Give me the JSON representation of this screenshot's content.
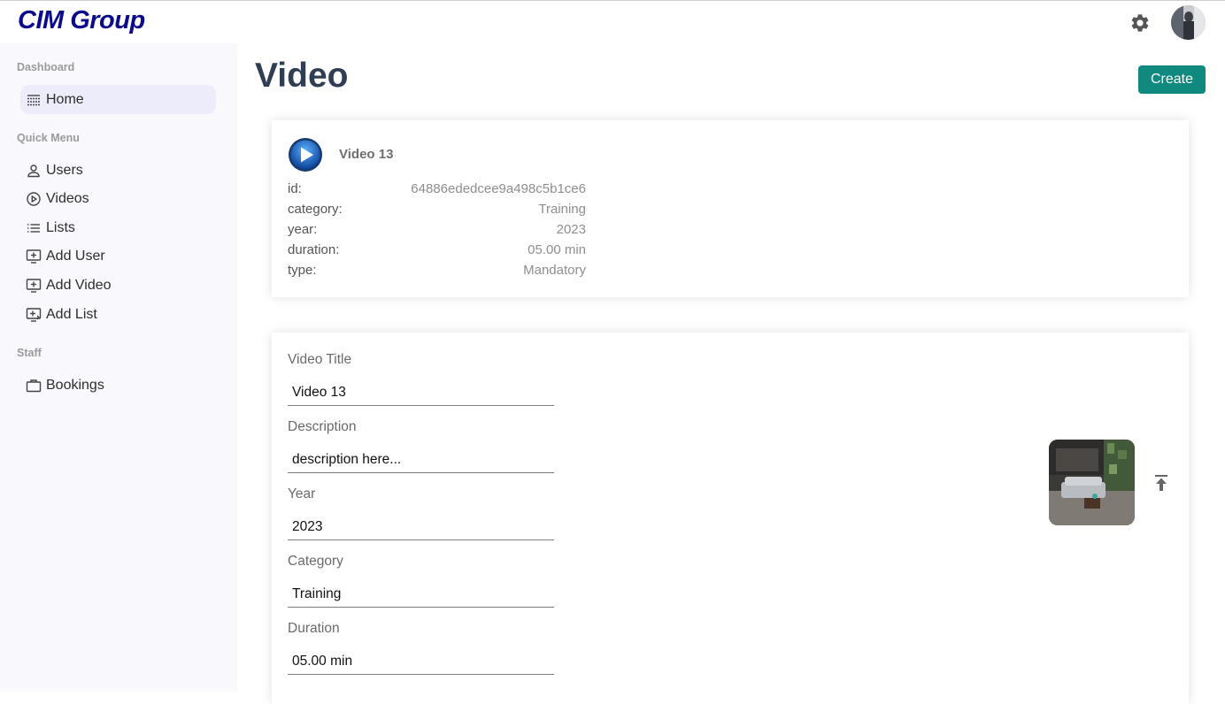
{
  "header": {
    "logo": "CIM Group",
    "settings_icon": "gear-icon",
    "avatar_icon": "user-avatar"
  },
  "sidebar": {
    "sections": [
      {
        "title": "Dashboard",
        "items": [
          {
            "label": "Home",
            "icon": "dashboard-icon",
            "active": true
          }
        ]
      },
      {
        "title": "Quick Menu",
        "items": [
          {
            "label": "Users",
            "icon": "user-icon"
          },
          {
            "label": "Videos",
            "icon": "play-circle-icon"
          },
          {
            "label": "Lists",
            "icon": "list-icon"
          },
          {
            "label": "Add User",
            "icon": "add-box-icon"
          },
          {
            "label": "Add Video",
            "icon": "add-box-icon"
          },
          {
            "label": "Add List",
            "icon": "add-list-icon"
          }
        ]
      },
      {
        "title": "Staff",
        "items": [
          {
            "label": "Bookings",
            "icon": "briefcase-icon"
          }
        ]
      }
    ]
  },
  "main": {
    "title": "Video",
    "create_label": "Create",
    "info": {
      "name": "Video 13",
      "rows": [
        {
          "key": "id:",
          "value": "64886ededcee9a498c5b1ce6"
        },
        {
          "key": "category:",
          "value": "Training"
        },
        {
          "key": "year:",
          "value": "2023"
        },
        {
          "key": "duration:",
          "value": "05.00 min"
        },
        {
          "key": "type:",
          "value": "Mandatory"
        }
      ]
    },
    "form": {
      "fields": [
        {
          "label": "Video Title",
          "value": "Video 13"
        },
        {
          "label": "Description",
          "value": "description here..."
        },
        {
          "label": "Year",
          "value": "2023"
        },
        {
          "label": "Category",
          "value": "Training"
        },
        {
          "label": "Duration",
          "value": "05.00 min"
        }
      ],
      "upload_icon": "upload-icon"
    }
  },
  "colors": {
    "accent": "#108a7f",
    "logo": "#0b0b8c",
    "sidebar_bg": "#f8f8fd",
    "active_item": "#ececfb"
  }
}
